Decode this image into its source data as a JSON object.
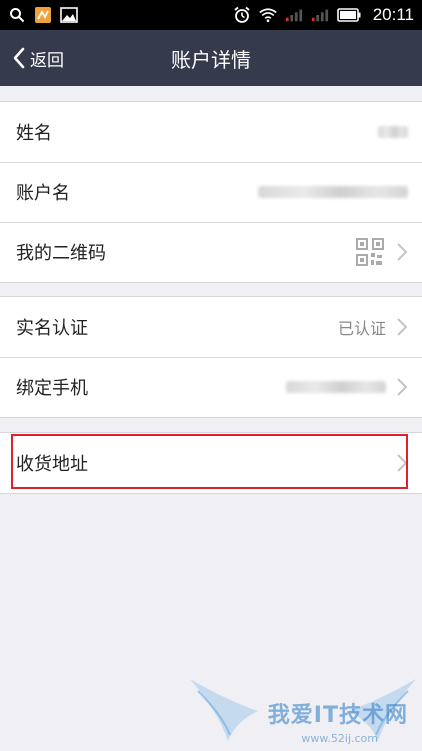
{
  "status_bar": {
    "time": "20:11",
    "left_icons": [
      "search-icon",
      "app-icon",
      "image-icon"
    ],
    "right_icons": [
      "alarm-icon",
      "wifi-icon",
      "signal-icon-1",
      "signal-icon-2",
      "battery-icon"
    ]
  },
  "nav": {
    "back_label": "返回",
    "title": "账户详情"
  },
  "group1": [
    {
      "label": "姓名"
    },
    {
      "label": "账户名"
    },
    {
      "label": "我的二维码"
    }
  ],
  "group2": [
    {
      "label": "实名认证",
      "value": "已认证"
    },
    {
      "label": "绑定手机"
    }
  ],
  "group3": [
    {
      "label": "收货地址"
    }
  ],
  "watermark": {
    "text": "我爱IT技术网",
    "url": "www.52ij.com"
  },
  "colors": {
    "nav_bg": "#353a4c",
    "page_bg": "#efeff4",
    "highlight": "#e0202a"
  }
}
